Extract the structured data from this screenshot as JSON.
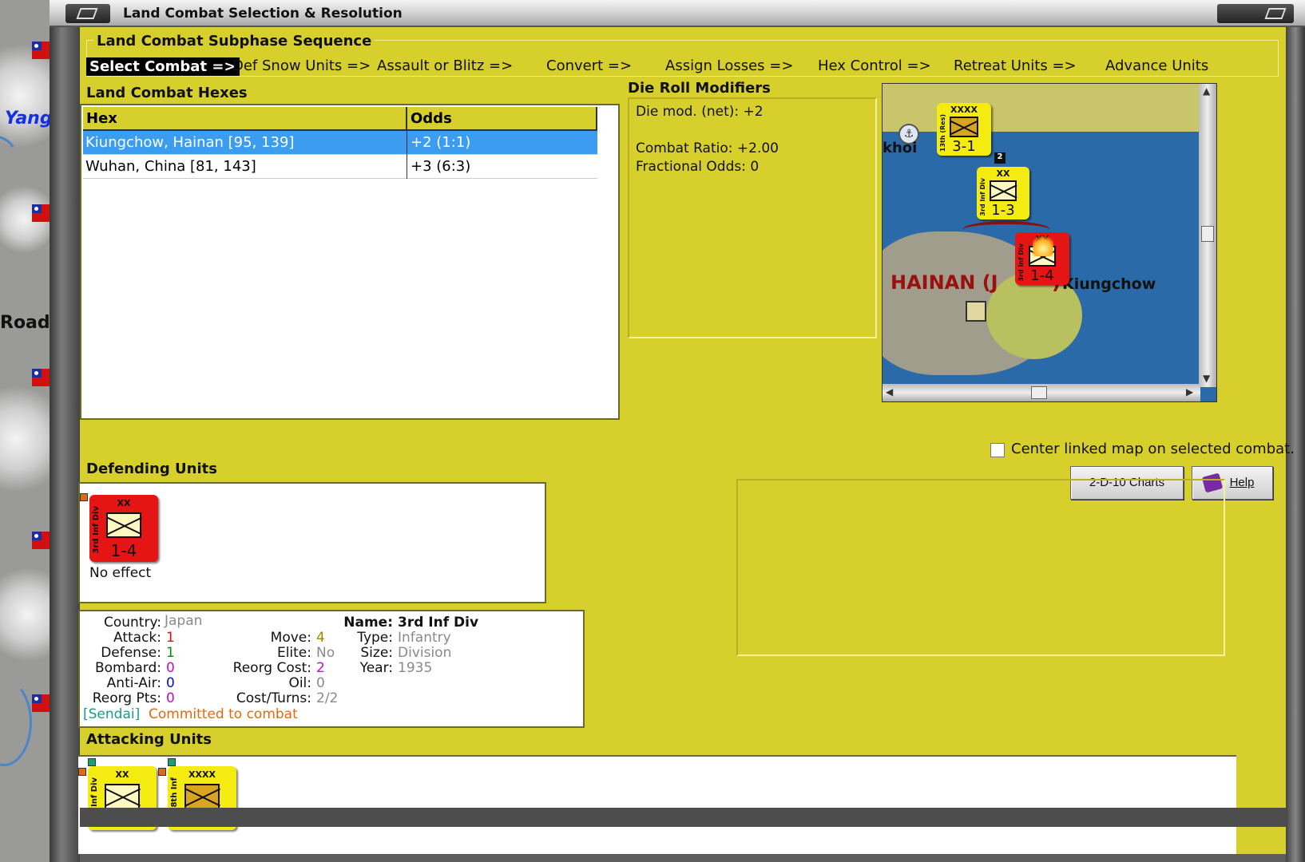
{
  "window": {
    "title": "Land Combat Selection & Resolution"
  },
  "background_map": {
    "labels": [
      "Yang",
      "Road"
    ]
  },
  "subphase": {
    "legend": "Land Combat Subphase Sequence",
    "steps": [
      "Select Combat =>",
      "Def Snow Units =>",
      "Assault or Blitz =>",
      "Convert =>",
      "Assign Losses =>",
      "Hex Control =>",
      "Retreat Units =>",
      "Advance Units"
    ]
  },
  "combat_hexes": {
    "title": "Land Combat Hexes",
    "columns": [
      "Hex",
      "Odds"
    ],
    "rows": [
      {
        "hex": "Kiungchow, Hainan [95, 139]",
        "odds": "+2 (1:1)"
      },
      {
        "hex": "Wuhan, China [81, 143]",
        "odds": "+3 (6:3)"
      }
    ]
  },
  "die_roll": {
    "title": "Die Roll Modifiers",
    "net": "Die mod. (net): +2",
    "ratio": "Combat Ratio: +2.00",
    "fractional": "Fractional Odds: 0"
  },
  "minimap": {
    "labels": {
      "hainan": "HAINAN (J",
      "hainan_tail": ")",
      "kiungchow": "Kiungchow",
      "khoi": "khoi"
    },
    "counters": [
      {
        "size": "XXXX",
        "strength": "3-1",
        "name": "13th (Res)"
      },
      {
        "size": "XX",
        "strength": "1-3",
        "name": "3rd Inf Div"
      },
      {
        "size": "XX",
        "strength": "1-4",
        "name": "3rd Inf Div"
      }
    ],
    "stack_count": "2"
  },
  "center_checkbox": {
    "label": "Center linked map on selected combat.",
    "checked": false
  },
  "buttons": {
    "charts": "2-D-10 Charts",
    "help": "Help"
  },
  "defending": {
    "title": "Defending Units",
    "units": [
      {
        "size": "XX",
        "strength": "1-4",
        "name": "3rd Inf Div",
        "result": "No effect"
      }
    ]
  },
  "unit_info": {
    "country_label": "Country:",
    "country": "Japan",
    "attack_label": "Attack:",
    "attack": "1",
    "defense_label": "Defense:",
    "defense": "1",
    "bombard_label": "Bombard:",
    "bombard": "0",
    "antiair_label": "Anti-Air:",
    "antiair": "0",
    "reorgpts_label": "Reorg Pts:",
    "reorgpts": "0",
    "move_label": "Move:",
    "move": "4",
    "elite_label": "Elite:",
    "elite": "No",
    "reorgcost_label": "Reorg Cost:",
    "reorgcost": "2",
    "oil_label": "Oil:",
    "oil": "0",
    "costturns_label": "Cost/Turns:",
    "costturns": "2/2",
    "name_label": "Name:",
    "name": "3rd Inf Div",
    "type_label": "Type:",
    "type": "Infantry",
    "size_label": "Size:",
    "size": "Division",
    "year_label": "Year:",
    "year": "1935",
    "home": "[Sendai]",
    "status": "Committed to combat"
  },
  "attacking": {
    "title": "Attacking Units",
    "units": [
      {
        "size": "XX",
        "name": "Inf Div"
      },
      {
        "size": "XXXX",
        "name": "8th Inf"
      }
    ]
  },
  "colors": {
    "panel": "#d7cf2c",
    "selection": "#3b9cf0",
    "red": "#e01010",
    "green": "#0a8a0a",
    "magenta": "#c010c0",
    "blue": "#1010c0",
    "olive": "#9a8a00",
    "gray": "#8a8a8a",
    "teal": "#1a9a8a",
    "orange": "#e06a10"
  }
}
